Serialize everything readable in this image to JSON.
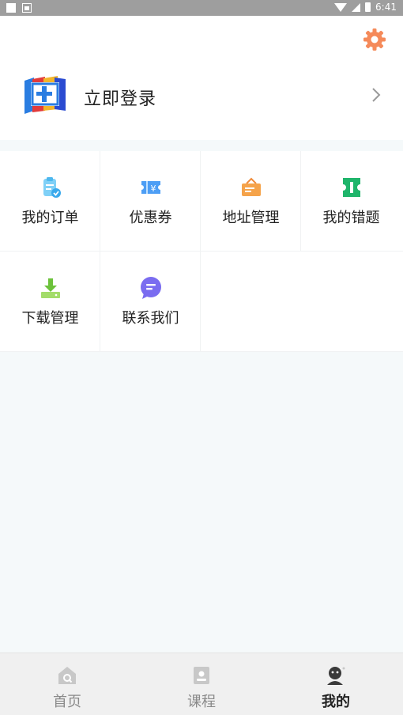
{
  "status_bar": {
    "time": "6:41"
  },
  "header": {
    "login_label": "立即登录",
    "settings_icon": "gear-icon",
    "accent_color": "#f58a5a"
  },
  "menu": {
    "items": [
      {
        "label": "我的订单",
        "icon": "order-clipboard-icon",
        "color": "#5cc3f5"
      },
      {
        "label": "优惠券",
        "icon": "coupon-ticket-icon",
        "color": "#4d9ef5"
      },
      {
        "label": "地址管理",
        "icon": "address-sign-icon",
        "color": "#f5a34a"
      },
      {
        "label": "我的错题",
        "icon": "wrong-questions-icon",
        "color": "#1fb56b"
      },
      {
        "label": "下载管理",
        "icon": "download-icon",
        "color": "#8bd14a"
      },
      {
        "label": "联系我们",
        "icon": "chat-bubble-icon",
        "color": "#7a6cf0"
      }
    ]
  },
  "bottom_nav": {
    "items": [
      {
        "label": "首页",
        "icon": "home-icon",
        "active": false
      },
      {
        "label": "课程",
        "icon": "course-book-icon",
        "active": false
      },
      {
        "label": "我的",
        "icon": "profile-icon",
        "active": true
      }
    ]
  }
}
